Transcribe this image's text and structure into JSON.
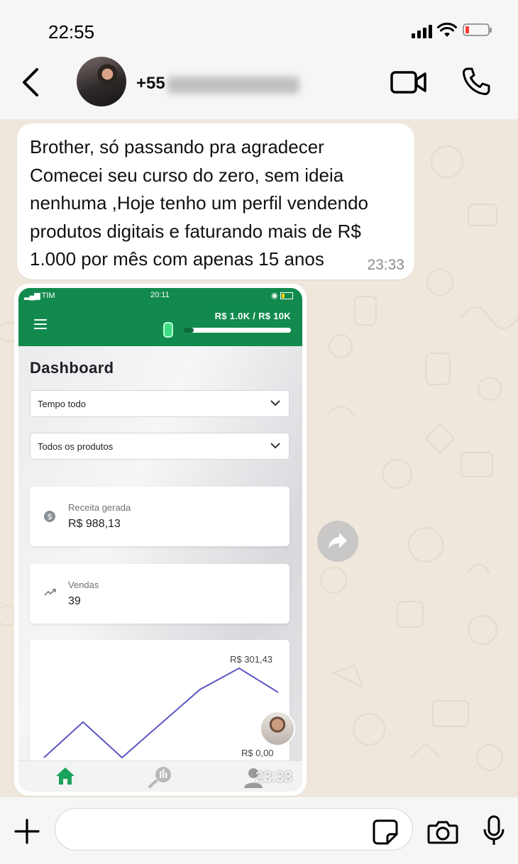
{
  "status_bar": {
    "time": "22:55"
  },
  "header": {
    "contact_prefix": "+55"
  },
  "messages": [
    {
      "text": "Brother, só passando pra agradecer\nComecei seu curso do zero, sem ideia\nnenhuma ,Hoje tenho um perfil vendendo\nprodutos digitais e faturando mais de R$\n1.000 por mês com apenas 15 anos",
      "time": "23:33"
    }
  ],
  "image_message": {
    "time": "23:33",
    "screenshot": {
      "status": {
        "carrier": "TIM",
        "time": "20:11"
      },
      "goal": {
        "text": "R$ 1.0K / R$ 10K",
        "progress_fraction": 0.1
      },
      "title": "Dashboard",
      "filters": [
        {
          "label": "Tempo todo"
        },
        {
          "label": "Todos os produtos"
        }
      ],
      "cards": [
        {
          "caption": "Receita gerada",
          "value": "R$ 988,13",
          "icon": "dollar-icon"
        },
        {
          "caption": "Vendas",
          "value": "39",
          "icon": "trending-up-icon"
        }
      ],
      "chart_data": {
        "type": "line",
        "max_label": "R$ 301,43",
        "min_label": "R$ 0,00",
        "values": [
          0,
          120,
          0,
          115,
          230,
          301.43,
          220
        ],
        "ylim": [
          0,
          301.43
        ],
        "color": "#5b57c2"
      },
      "nav": [
        "home-icon",
        "analytics-icon",
        "person-icon"
      ]
    }
  },
  "input": {
    "placeholder": ""
  },
  "colors": {
    "whatsapp_bg": "#efe7dc",
    "app_green": "#128a4e"
  }
}
